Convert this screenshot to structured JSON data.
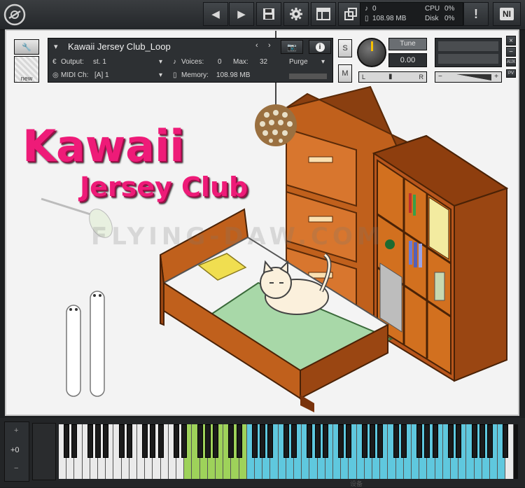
{
  "toolbar": {
    "logo": "kontakt-logo-icon",
    "prev_icon": "chevron-left-icon",
    "next_icon": "chevron-right-icon",
    "save_icon": "floppy-disk-icon",
    "settings_icon": "gear-icon",
    "view_icon": "layout-icon",
    "resize_icon": "resize-icon",
    "alert_icon": "exclamation-icon",
    "ni_label": "NI"
  },
  "stats": {
    "midi_count": "0",
    "memory": "108.98 MB",
    "cpu_label": "CPU",
    "cpu_value": "0%",
    "disk_label": "Disk",
    "disk_value": "0%"
  },
  "instrument": {
    "name": "Kawaii Jersey Club_Loop",
    "output_label": "Output:",
    "output_value": "st. 1",
    "voices_label": "Voices:",
    "voices_value": "0",
    "max_label": "Max:",
    "max_value": "32",
    "purge_label": "Purge",
    "midi_label": "MIDI Ch:",
    "midi_value": "[A]  1",
    "memory_label": "Memory:",
    "memory_value": "108.98 MB",
    "new_label": "new",
    "solo_label": "S",
    "mute_label": "M",
    "tune_label": "Tune",
    "tune_value": "0.00",
    "pan_left": "L",
    "pan_right": "R",
    "aux_label": "AUX",
    "pv_label": "PV",
    "vol_minus": "−",
    "vol_plus": "+",
    "close_label": "×",
    "min_label": "−"
  },
  "artwork": {
    "title_line1": "Kawaii",
    "title_line2": "Jersey Club",
    "watermark": "FLYING-DAW.COM"
  },
  "keyboard": {
    "pitch_plus": "+",
    "octave": "+0",
    "pitch_minus": "−",
    "bottom_text": "设备"
  },
  "colors": {
    "title_pink": "#ee1b78",
    "key_green": "#9ed25a",
    "key_blue": "#5fc8de",
    "blanket": "#a8d8a8",
    "wood": "#b8561c"
  }
}
